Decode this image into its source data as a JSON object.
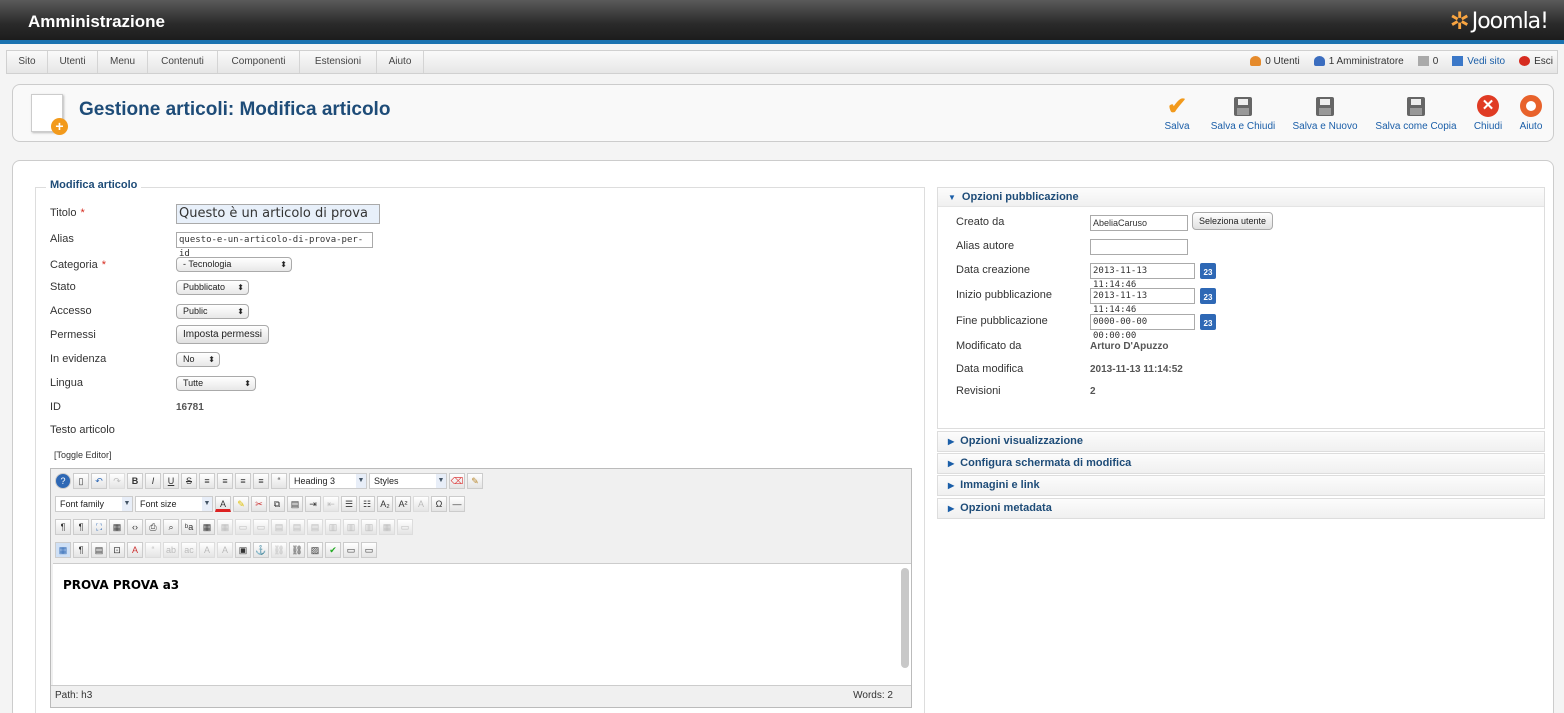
{
  "header": {
    "title": "Amministrazione",
    "logo_text": "Joomla!"
  },
  "menu": {
    "items": [
      "Sito",
      "Utenti",
      "Menu",
      "Contenuti",
      "Componenti",
      "Estensioni",
      "Aiuto"
    ],
    "status": {
      "users": "0 Utenti",
      "admins": "1 Amministratore",
      "messages": "0",
      "view_site": "Vedi sito",
      "logout": "Esci"
    }
  },
  "toolbar": {
    "title": "Gestione articoli: Modifica articolo",
    "buttons": [
      "Salva",
      "Salva e Chiudi",
      "Salva e Nuovo",
      "Salva come Copia",
      "Chiudi",
      "Aiuto"
    ]
  },
  "form": {
    "legend": "Modifica articolo",
    "required_mark": "*",
    "labels": {
      "title": "Titolo",
      "alias": "Alias",
      "category": "Categoria",
      "state": "Stato",
      "access": "Accesso",
      "permissions": "Permessi",
      "featured": "In evidenza",
      "language": "Lingua",
      "id": "ID",
      "text": "Testo articolo"
    },
    "values": {
      "title": "Questo è un articolo di prova",
      "alias": "questo-e-un-articolo-di-prova-per-id",
      "category": "- Tecnologia",
      "state": "Pubblicato",
      "access": "Public",
      "permissions_button": "Imposta permessi",
      "featured": "No",
      "language": "Tutte",
      "id": "16781"
    },
    "toggle_editor": "[Toggle Editor]"
  },
  "editor": {
    "format": "Heading 3",
    "styles": "Styles",
    "font_family": "Font family",
    "font_size": "Font size",
    "content": "PROVA PROVA a3",
    "path": "Path:  h3",
    "words": "Words: 2"
  },
  "publishing": {
    "heading": "Opzioni pubblicazione",
    "labels": {
      "created_by": "Creato da",
      "author_alias": "Alias autore",
      "created": "Data creazione",
      "publish_up": "Inizio pubblicazione",
      "publish_down": "Fine pubblicazione",
      "modified_by": "Modificato da",
      "modified": "Data modifica",
      "revisions": "Revisioni"
    },
    "values": {
      "created_by": "AbeliaCaruso",
      "select_user": "Seleziona utente",
      "author_alias": "",
      "created": "2013-11-13 11:14:46",
      "publish_up": "2013-11-13 11:14:46",
      "publish_down": "0000-00-00 00:00:00",
      "modified_by": "Arturo D'Apuzzo",
      "modified": "2013-11-13 11:14:52",
      "revisions": "2"
    },
    "calendar_icon_text": "23"
  },
  "collapsed_panels": [
    "Opzioni visualizzazione",
    "Configura schermata di modifica",
    "Immagini e link",
    "Opzioni metadata"
  ]
}
